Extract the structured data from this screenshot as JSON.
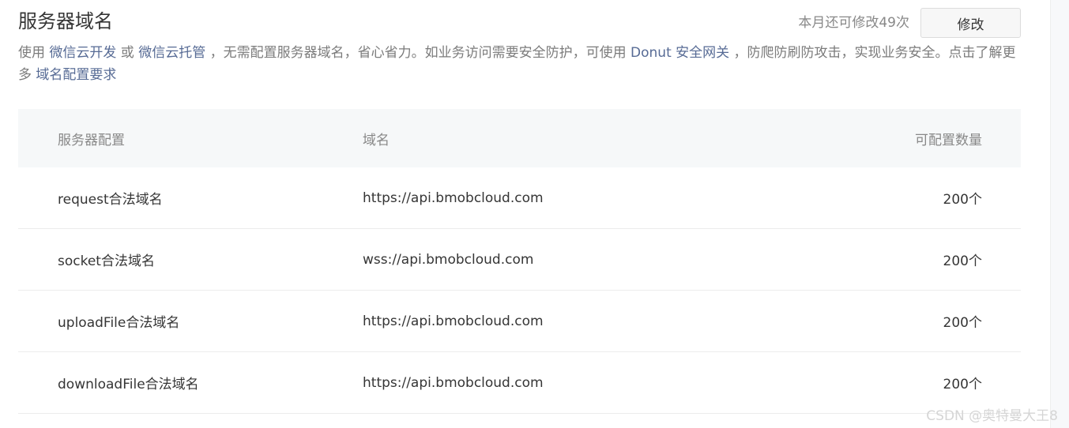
{
  "section": {
    "title": "服务器域名",
    "remaining": "本月还可修改49次",
    "modify_label": "修改",
    "description": {
      "p1": "使用 ",
      "link1": "微信云开发",
      "p2": " 或 ",
      "link2": "微信云托管",
      "p3": " ，无需配置服务器域名，省心省力。如业务访问需要安全防护，可使用 ",
      "link3": "Donut 安全网关",
      "p4": " ，防爬防刷防攻击，实现业务安全。点击了解更多 ",
      "link4": "域名配置要求"
    }
  },
  "table": {
    "headers": [
      "服务器配置",
      "域名",
      "可配置数量"
    ],
    "rows": [
      {
        "config": "request合法域名",
        "domain": "https://api.bmobcloud.com",
        "count": "200个"
      },
      {
        "config": "socket合法域名",
        "domain": "wss://api.bmobcloud.com",
        "count": "200个"
      },
      {
        "config": "uploadFile合法域名",
        "domain": "https://api.bmobcloud.com",
        "count": "200个"
      },
      {
        "config": "downloadFile合法域名",
        "domain": "https://api.bmobcloud.com",
        "count": "200个"
      }
    ]
  },
  "watermark": "CSDN @奥特曼大王8"
}
